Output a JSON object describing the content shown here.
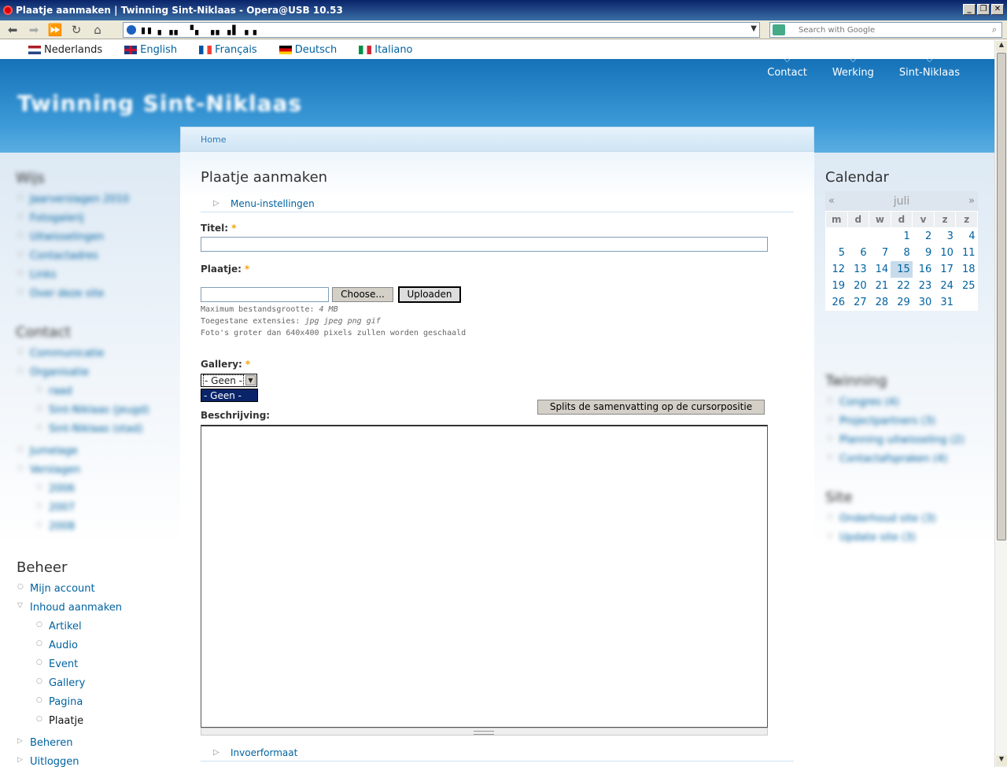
{
  "window": {
    "title": "Plaatje aanmaken | Twinning Sint-Niklaas - Opera@USB 10.53"
  },
  "browser": {
    "url": "▮▮ ▖▗▖ ▝▖ ▗▖▗▌ ▖▖",
    "search_placeholder": "Search with Google"
  },
  "languages": [
    {
      "label": "Nederlands",
      "flag": "nl",
      "active": true
    },
    {
      "label": "English",
      "flag": "en"
    },
    {
      "label": "Français",
      "flag": "fr"
    },
    {
      "label": "Deutsch",
      "flag": "de"
    },
    {
      "label": "Italiano",
      "flag": "it"
    }
  ],
  "header": {
    "site_title": "Twinning Sint-Niklaas",
    "links": [
      "Contact",
      "Werking",
      "Sint-Niklaas"
    ]
  },
  "main": {
    "breadcrumb": "Home",
    "title": "Plaatje aanmaken",
    "menu_settings": "Menu-instellingen",
    "title_label": "Titel:",
    "image_label": "Plaatje:",
    "choose_btn": "Choose...",
    "upload_btn": "Uploaden",
    "desc1": "Maximum bestandsgrootte: ",
    "desc1_val": "4 MB",
    "desc2": "Toegestane extensies: ",
    "desc2_val": "jpg jpeg png gif",
    "desc3": "Foto's groter dan 640x400 pixels zullen worden geschaald",
    "gallery_label": "Gallery:",
    "gallery_value": "- Geen -",
    "gallery_option": "- Geen -",
    "split_btn": "Splits de samenvatting op de cursorpositie",
    "body_label": "Beschrijving:",
    "input_format": "Invoerformaat",
    "required_mark": "*"
  },
  "sidebar_left": {
    "blurred_title1": "Wijs",
    "blurred_items1": [
      "Jaarverslagen 2010",
      "Fotogalerij",
      "Uitwisselingen",
      "Contactadres",
      "Links",
      "Over deze site"
    ],
    "blurred_title2": "Contact",
    "blurred_items2": [
      "Communicatie",
      "Organisatie",
      "raad",
      "Sint-Niklaas (jeugd)",
      "Sint-Niklaas (stad)",
      "Jumelage",
      "Verslagen",
      "2006",
      "2007",
      "2008"
    ],
    "admin_title": "Beheer",
    "admin_items": [
      "Mijn account",
      "Inhoud aanmaken",
      "Artikel",
      "Audio",
      "Event",
      "Gallery",
      "Pagina",
      "Plaatje",
      "Beheren",
      "Uitloggen"
    ]
  },
  "sidebar_right": {
    "calendar_title": "Calendar",
    "month": "juli",
    "prev": "«",
    "next": "»",
    "weekdays": [
      "m",
      "d",
      "w",
      "d",
      "v",
      "z",
      "z"
    ],
    "weeks": [
      [
        "",
        "",
        "",
        "1",
        "2",
        "3",
        "4"
      ],
      [
        "5",
        "6",
        "7",
        "8",
        "9",
        "10",
        "11"
      ],
      [
        "12",
        "13",
        "14",
        "15",
        "16",
        "17",
        "18"
      ],
      [
        "19",
        "20",
        "21",
        "22",
        "23",
        "24",
        "25"
      ],
      [
        "26",
        "27",
        "28",
        "29",
        "30",
        "31",
        ""
      ]
    ],
    "today": "15",
    "blurred_title1": "Twinning",
    "blurred_items1": [
      "Congres (4)",
      "Projectpartners (3)",
      "Planning uitwisseling (2)",
      "Contactafspraken (4)"
    ],
    "blurred_title2": "Site",
    "blurred_items2": [
      "Onderhoud site (3)",
      "Update site (3)"
    ]
  },
  "colors": {
    "link": "#0062a0",
    "header_blue": "#2b88cc",
    "required": "#f5a000",
    "selection": "#0a246a"
  }
}
